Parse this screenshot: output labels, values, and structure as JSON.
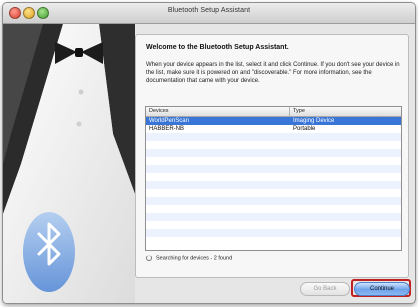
{
  "window": {
    "title": "Bluetooth Setup Assistant"
  },
  "content": {
    "heading": "Welcome to the Bluetooth Setup Assistant.",
    "description": "When your device appears in the list, select it and click Continue. If you don't see your device in the list, make sure it is powered on and \"discoverable.\" For more information, see the documentation that came with your device."
  },
  "table": {
    "headers": {
      "devices": "Devices",
      "type": "Type"
    },
    "rows": [
      {
        "device": "WorldPenScan",
        "type": "Imaging Device"
      },
      {
        "device": "HABBER-NB",
        "type": "Portable"
      }
    ],
    "selected_row": 0
  },
  "status": {
    "text": "Searching for devices - 2 found"
  },
  "buttons": {
    "back": "Go Back",
    "continue": "Continue"
  },
  "colors": {
    "selection": "#3875d7",
    "highlight": "#c02020",
    "accent_button": "#6ea2ea"
  },
  "icons": {
    "bluetooth": "bluetooth-icon",
    "spinner": "spinner-icon"
  }
}
